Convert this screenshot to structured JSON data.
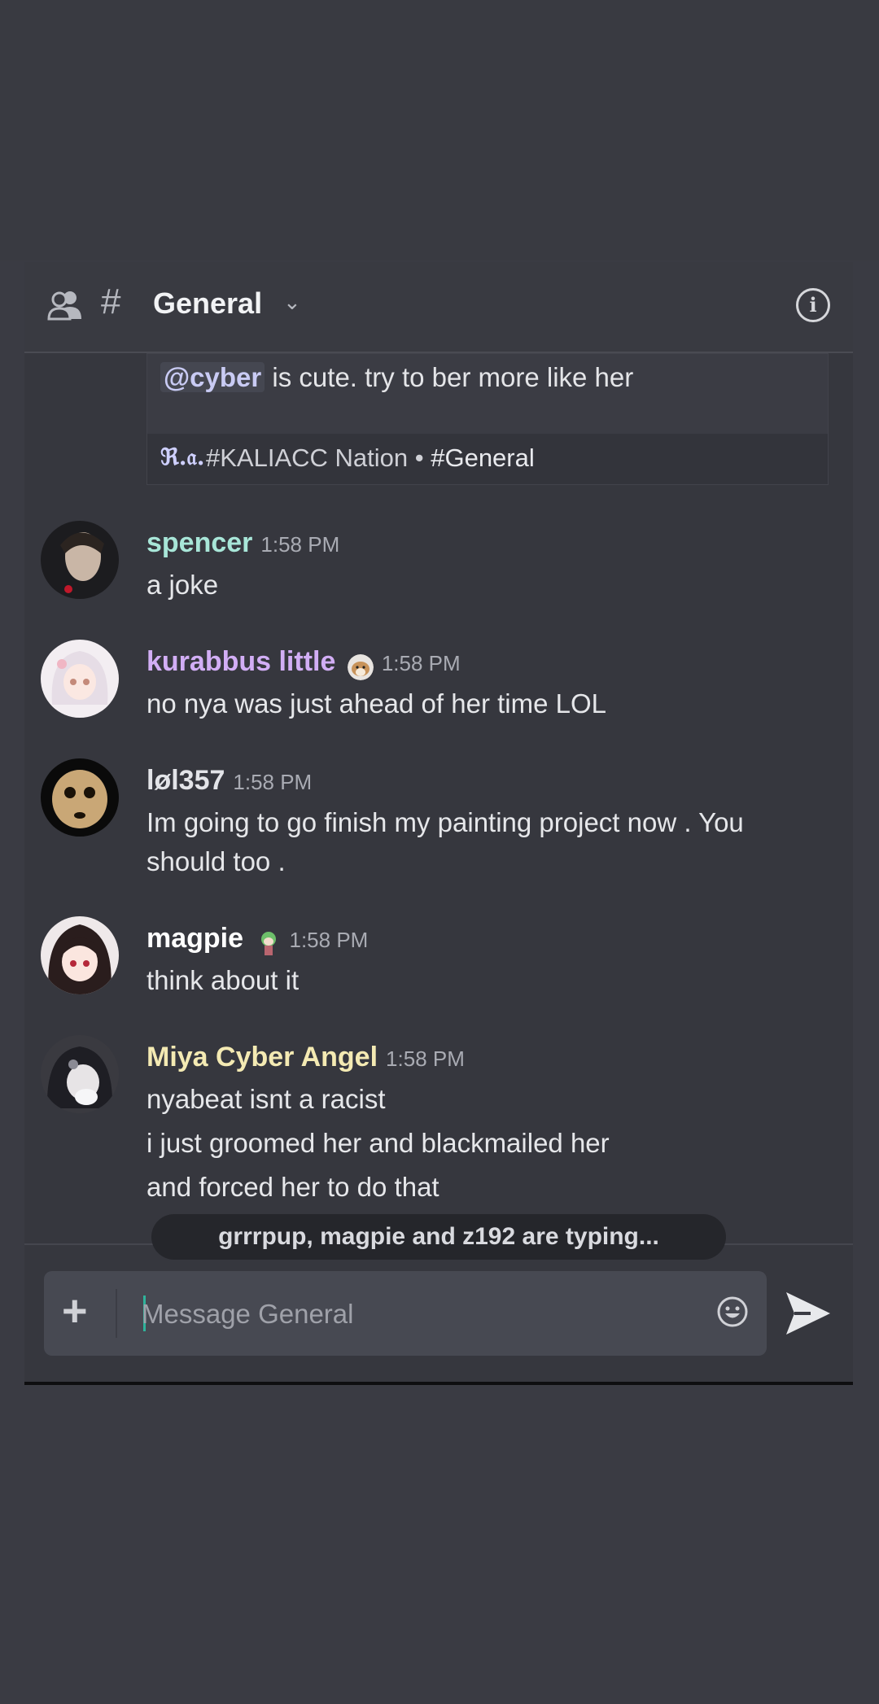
{
  "header": {
    "channel_prefix": "#",
    "channel_name": "General",
    "chevron": "⌄",
    "info_label": "i"
  },
  "quote": {
    "mention": "@cyber",
    "text": " is cute. try to ber more like her",
    "server_logo": "ℜ.𝔞.",
    "server_name": "#KALIACC Nation",
    "separator": " • ",
    "channel": "#General"
  },
  "messages": [
    {
      "author": "spencer",
      "author_color": "#a8e6d8",
      "time": "1:58 PM",
      "lines": [
        "a joke"
      ]
    },
    {
      "author": "kurabbus little",
      "author_color": "#d2aef5",
      "time": "1:58 PM",
      "lines": [
        "no nya was just ahead of her time LOL"
      ]
    },
    {
      "author": "løl357",
      "author_color": "#e3e4e8",
      "time": "1:58 PM",
      "lines": [
        "Im going to go finish my painting project now . You",
        "should too ."
      ]
    },
    {
      "author": "magpie",
      "author_color": "#ffffff",
      "time": "1:58 PM",
      "lines": [
        "think about it"
      ]
    },
    {
      "author": "Miya Cyber Angel",
      "author_color": "#f4eab3",
      "time": "1:58 PM",
      "lines": [
        "nyabeat isnt a racist",
        "i just groomed her and blackmailed her",
        "and forced her to do that"
      ]
    }
  ],
  "typing_indicator": "grrrpup, magpie and z192 are typing...",
  "composer": {
    "plus_label": "+",
    "placeholder": "Message General"
  },
  "icons": {
    "friends": "friends-icon",
    "info": "info-icon",
    "emoji": "emoji-icon",
    "send": "send-icon"
  }
}
